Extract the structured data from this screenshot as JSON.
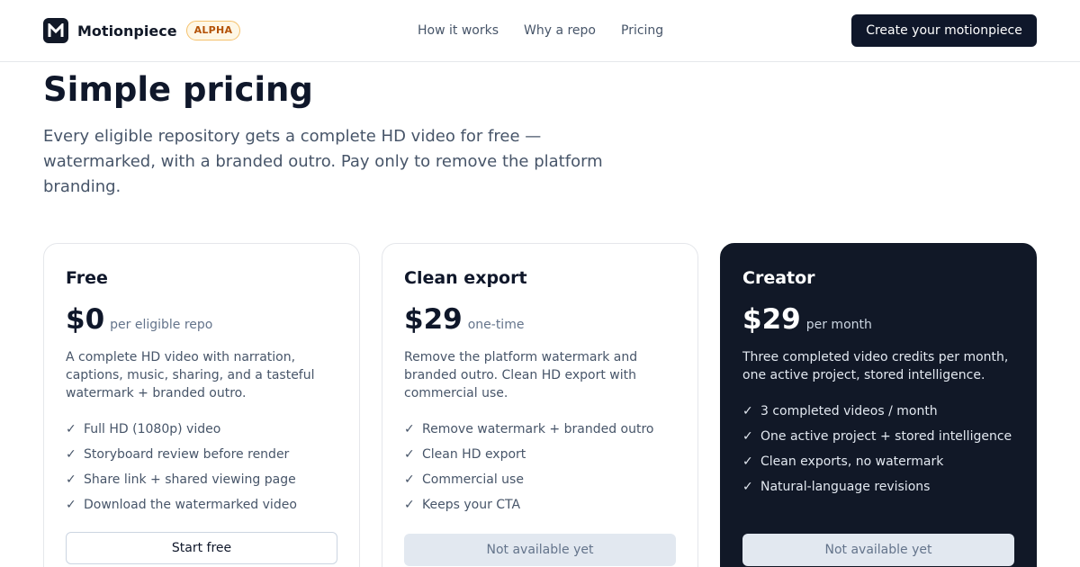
{
  "header": {
    "brand_name": "Motionpiece",
    "logo_letter": "M",
    "badge": "ALPHA",
    "nav": [
      "How it works",
      "Why a repo",
      "Pricing"
    ],
    "cta": "Create your motionpiece"
  },
  "hero": {
    "title": "Simple pricing",
    "subtitle": "Every eligible repository gets a complete HD video for free — watermarked, with a branded outro. Pay only to remove the platform branding."
  },
  "plans": [
    {
      "name": "Free",
      "price": "$0",
      "period": "per eligible repo",
      "description": "A complete HD video with narration, captions, music, sharing, and a tasteful watermark + branded outro.",
      "features": [
        "Full HD (1080p) video",
        "Storyboard review before render",
        "Share link + shared viewing page",
        "Download the watermarked video"
      ],
      "button": "Start free"
    },
    {
      "name": "Clean export",
      "price": "$29",
      "period": "one-time",
      "description": "Remove the platform watermark and branded outro. Clean HD export with commercial use.",
      "features": [
        "Remove watermark + branded outro",
        "Clean HD export",
        "Commercial use",
        "Keeps your CTA"
      ],
      "button": "Not available yet"
    },
    {
      "name": "Creator",
      "price": "$29",
      "period": "per month",
      "description": "Three completed video credits per month, one active project, stored intelligence.",
      "features": [
        "3 completed videos / month",
        "One active project + stored intelligence",
        "Clean exports, no watermark",
        "Natural-language revisions"
      ],
      "button": "Not available yet"
    }
  ],
  "check_glyph": "✓",
  "colors": {
    "primary_dark": "#0f172a",
    "badge_text": "#b45309",
    "badge_bg": "#fef7e6"
  }
}
